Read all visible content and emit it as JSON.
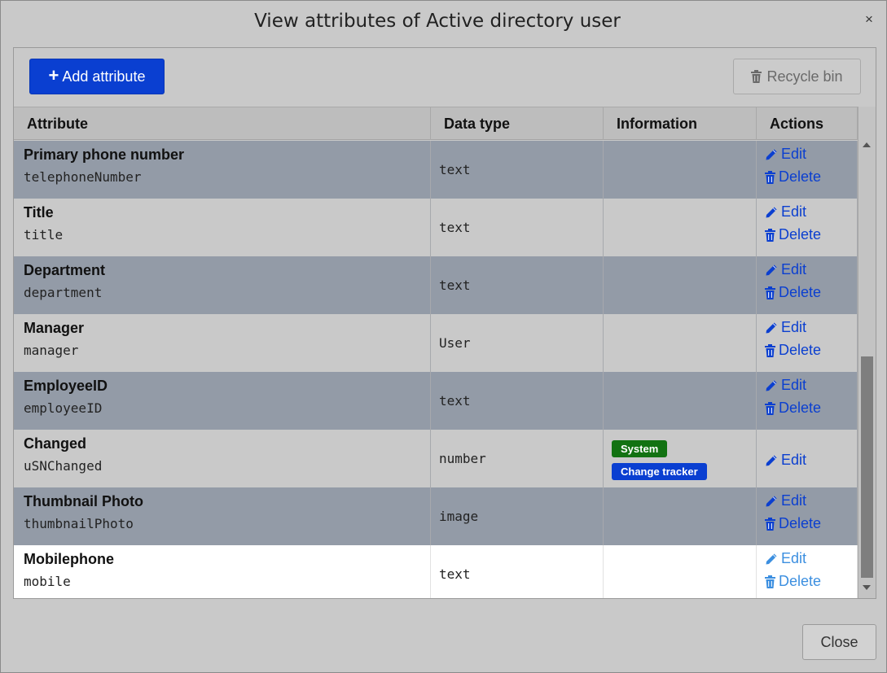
{
  "dialog": {
    "title": "View attributes of Active directory user",
    "close_icon": "×",
    "close_button_label": "Close"
  },
  "toolbar": {
    "add_label": "Add attribute",
    "recycle_label": "Recycle bin"
  },
  "table": {
    "headers": [
      "Attribute",
      "Data type",
      "Information",
      "Actions"
    ],
    "rows": [
      {
        "label": "Primary phone number",
        "name": "telephoneNumber",
        "type": "text",
        "edit": "Edit",
        "delete": "Delete"
      },
      {
        "label": "Title",
        "name": "title",
        "type": "text",
        "edit": "Edit",
        "delete": "Delete"
      },
      {
        "label": "Department",
        "name": "department",
        "type": "text",
        "edit": "Edit",
        "delete": "Delete"
      },
      {
        "label": "Manager",
        "name": "manager",
        "type": "User",
        "edit": "Edit",
        "delete": "Delete"
      },
      {
        "label": "EmployeeID",
        "name": "employeeID",
        "type": "text",
        "edit": "Edit",
        "delete": "Delete"
      },
      {
        "label": "Changed",
        "name": "uSNChanged",
        "type": "number",
        "badges": [
          "System",
          "Change tracker"
        ],
        "edit": "Edit"
      },
      {
        "label": "Thumbnail Photo",
        "name": "thumbnailPhoto",
        "type": "image",
        "edit": "Edit",
        "delete": "Delete"
      },
      {
        "label": "Mobilephone",
        "name": "mobile",
        "type": "text",
        "edit": "Edit",
        "delete": "Delete"
      }
    ]
  },
  "colors": {
    "primary": "#0a3fd1",
    "system_badge": "#127212",
    "row_dark": "#939ba7",
    "row_light": "#c9c9c9"
  },
  "icons": {
    "add": "plus-icon",
    "recycle": "trash-icon",
    "edit": "pencil-icon",
    "delete": "trash-icon"
  }
}
